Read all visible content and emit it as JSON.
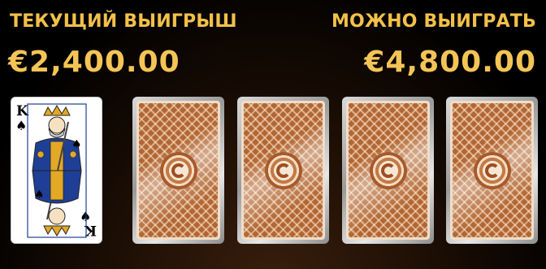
{
  "current_win": {
    "label": "ТЕКУЩИЙ ВЫИГРЫШ",
    "amount": "€2,400.00"
  },
  "potential_win": {
    "label": "МОЖНО ВЫИГРАТЬ",
    "amount": "€4,800.00"
  },
  "cards": [
    {
      "state": "face-up",
      "rank": "K",
      "suit": "♠",
      "color": "#000000"
    },
    {
      "state": "face-down"
    },
    {
      "state": "face-down"
    },
    {
      "state": "face-down"
    },
    {
      "state": "face-down"
    }
  ],
  "colors": {
    "accent_gold": "#f2c04a",
    "card_back": "#b26633"
  }
}
